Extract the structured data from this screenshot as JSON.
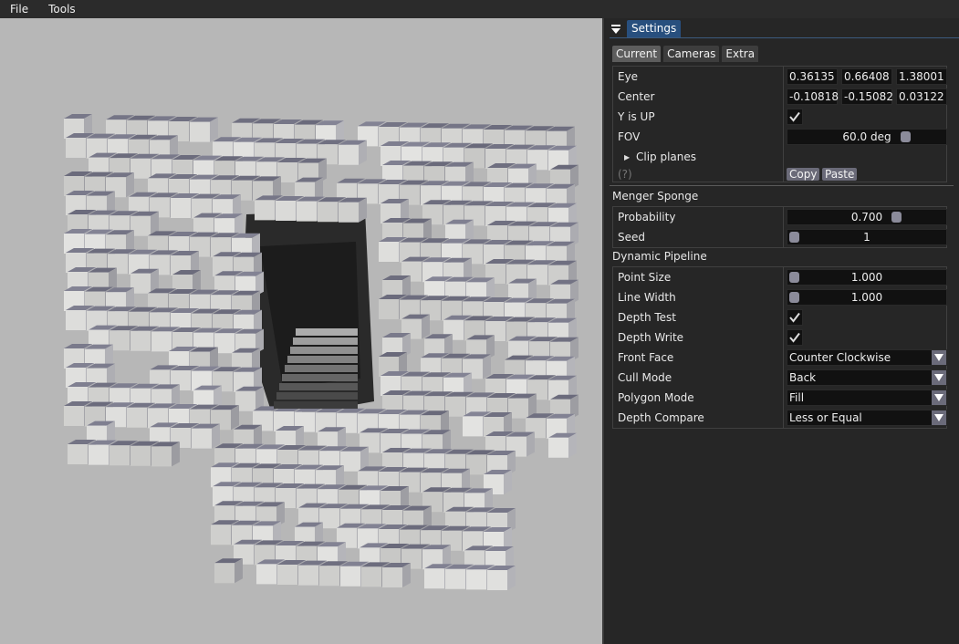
{
  "menubar": {
    "items": [
      "File",
      "Tools"
    ]
  },
  "panel": {
    "title": "Settings",
    "tabs": [
      "Current",
      "Cameras",
      "Extra"
    ],
    "camera": {
      "eye_label": "Eye",
      "eye": [
        "0.36135",
        "0.66408",
        "1.38001"
      ],
      "center_label": "Center",
      "center": [
        "-0.10818",
        "-0.15082",
        "0.03122"
      ],
      "yup_label": "Y is UP",
      "yup_checked": true,
      "fov_label": "FOV",
      "fov_value": "60.0 deg",
      "fov_fraction": 0.76,
      "clip_label": "Clip planes",
      "help": "(?)",
      "copy_label": "Copy",
      "paste_label": "Paste"
    },
    "sponge": {
      "header": "Menger Sponge",
      "probability_label": "Probability",
      "probability_value": "0.700",
      "probability_fraction": 0.7,
      "seed_label": "Seed",
      "seed_value": "1",
      "seed_fraction": 0.0
    },
    "pipeline": {
      "header": "Dynamic Pipeline",
      "point_size_label": "Point Size",
      "point_size_value": "1.000",
      "point_size_fraction": 0.0,
      "line_width_label": "Line Width",
      "line_width_value": "1.000",
      "line_width_fraction": 0.0,
      "depth_test_label": "Depth Test",
      "depth_test_checked": true,
      "depth_write_label": "Depth Write",
      "depth_write_checked": true,
      "front_face_label": "Front Face",
      "front_face_value": "Counter Clockwise",
      "cull_mode_label": "Cull Mode",
      "cull_mode_value": "Back",
      "polygon_mode_label": "Polygon Mode",
      "polygon_mode_value": "Fill",
      "depth_compare_label": "Depth Compare",
      "depth_compare_value": "Less or Equal"
    }
  },
  "colors": {
    "title_tab": "#284f7e",
    "viewport_bg": "#b7b7b7",
    "grab": "#8b8b9a"
  }
}
